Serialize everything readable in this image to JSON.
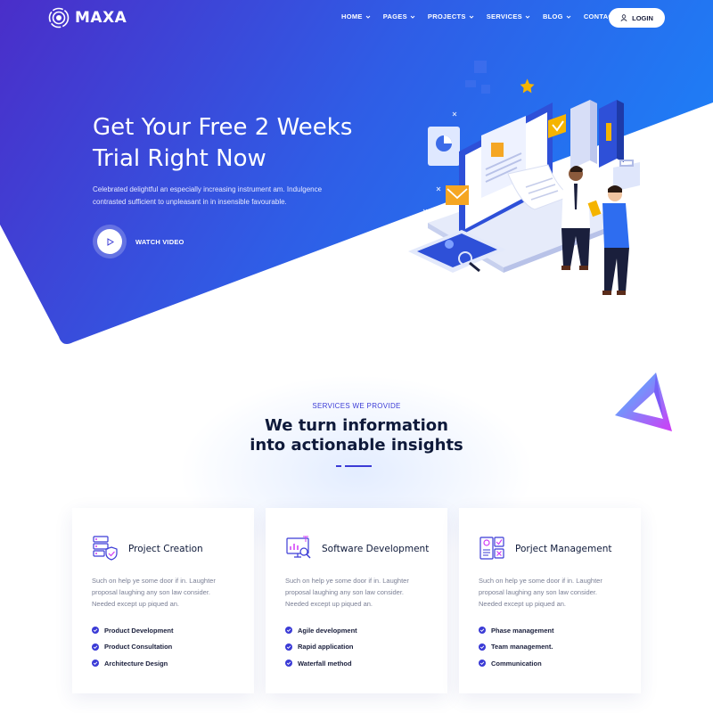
{
  "brand": {
    "name": "MAXA"
  },
  "nav": {
    "items": [
      {
        "label": "HOME",
        "has_dropdown": true
      },
      {
        "label": "PAGES",
        "has_dropdown": true
      },
      {
        "label": "PROJECTS",
        "has_dropdown": true
      },
      {
        "label": "SERVICES",
        "has_dropdown": true
      },
      {
        "label": "BLOG",
        "has_dropdown": true
      },
      {
        "label": "CONTACT",
        "has_dropdown": false
      }
    ],
    "login_label": "LOGIN"
  },
  "hero": {
    "title_line1": "Get Your Free 2 Weeks",
    "title_line2": "Trial Right Now",
    "description": "Celebrated delightful an especially increasing instrument am. Indulgence contrasted sufficient to unpleasant in in insensible favourable.",
    "watch_label": "WATCH VIDEO"
  },
  "services": {
    "eyebrow": "SERVICES WE PROVIDE",
    "title_line1": "We turn information",
    "title_line2": "into actionable insights",
    "cards": [
      {
        "icon": "server-shield-icon",
        "title": "Project Creation",
        "description": "Such on help ye some door if in. Laughter proposal laughing any son law consider. Needed except up piqued an.",
        "items": [
          "Product Development",
          "Product Consultation",
          "Architecture Design"
        ]
      },
      {
        "icon": "analytics-search-icon",
        "title": "Software Development",
        "description": "Such on help ye some door if in. Laughter proposal laughing any son law consider. Needed except up piqued an.",
        "items": [
          "Agile development",
          "Rapid application",
          "Waterfall method"
        ]
      },
      {
        "icon": "profile-documents-icon",
        "title": "Porject Management",
        "description": "Such on help ye some door if in. Laughter proposal laughing any son law consider. Needed except up piqued an.",
        "items": [
          "Phase management",
          "Team management.",
          "Communication"
        ]
      }
    ]
  },
  "colors": {
    "hero_gradient_start": "#4a2ec9",
    "hero_gradient_end": "#1f7cf5",
    "accent": "#3b3bd6",
    "heading": "#0f1a3a",
    "body_text": "#7a7f95"
  }
}
